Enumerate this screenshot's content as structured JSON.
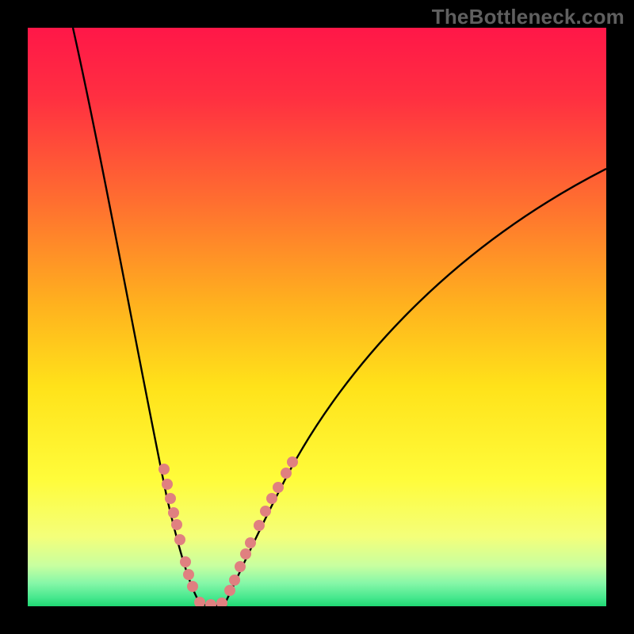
{
  "watermark": "TheBottleneck.com",
  "chart_data": {
    "type": "line",
    "title": "",
    "xlabel": "",
    "ylabel": "",
    "xlim": [
      0,
      100
    ],
    "ylim": [
      0,
      100
    ],
    "background_gradient": {
      "direction": "vertical",
      "stops": [
        {
          "pos": 0.0,
          "color": "#ff1748"
        },
        {
          "pos": 0.12,
          "color": "#ff2f41"
        },
        {
          "pos": 0.3,
          "color": "#ff6e30"
        },
        {
          "pos": 0.48,
          "color": "#ffb21e"
        },
        {
          "pos": 0.62,
          "color": "#ffe21a"
        },
        {
          "pos": 0.78,
          "color": "#fffc3a"
        },
        {
          "pos": 0.88,
          "color": "#f4ff7a"
        },
        {
          "pos": 0.93,
          "color": "#c8ffa0"
        },
        {
          "pos": 0.96,
          "color": "#86f7a8"
        },
        {
          "pos": 0.985,
          "color": "#47e88e"
        },
        {
          "pos": 1.0,
          "color": "#1fd873"
        }
      ]
    },
    "series": [
      {
        "name": "bottleneck-curve",
        "style": "line",
        "color": "#000000",
        "x": [
          7.8,
          13.0,
          18.5,
          24.0,
          28.1,
          29.6,
          31.6,
          34.2,
          37.0,
          45.0,
          55.0,
          72.0,
          100.0
        ],
        "y": [
          100.0,
          76.7,
          42.5,
          19.2,
          3.5,
          0.8,
          0.0,
          0.8,
          3.5,
          23.3,
          43.0,
          64.0,
          75.6
        ]
      },
      {
        "name": "highlighted-points",
        "style": "scatter",
        "color": "#e08080",
        "x": [
          23.6,
          24.1,
          24.7,
          25.2,
          25.8,
          26.3,
          27.3,
          27.8,
          28.5,
          29.7,
          31.6,
          33.6,
          34.9,
          35.8,
          36.7,
          37.7,
          38.5,
          40.0,
          41.1,
          42.2,
          43.3,
          44.7,
          45.8
        ],
        "y": [
          23.7,
          21.1,
          18.6,
          16.2,
          14.1,
          11.5,
          7.7,
          5.5,
          3.4,
          0.7,
          0.3,
          0.5,
          2.7,
          4.5,
          6.8,
          9.0,
          11.0,
          14.0,
          16.4,
          18.6,
          20.5,
          23.0,
          24.9
        ]
      }
    ],
    "annotations": []
  }
}
